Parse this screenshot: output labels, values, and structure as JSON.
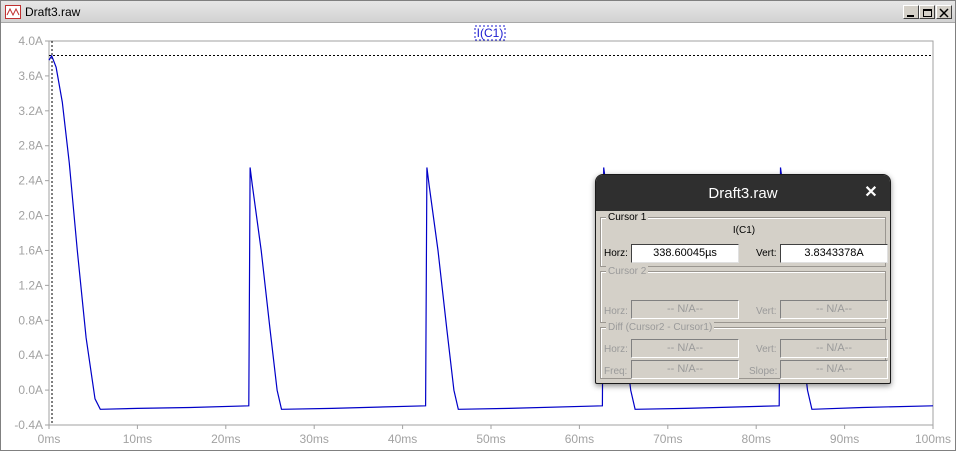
{
  "window": {
    "title": "Draft3.raw",
    "controls": [
      "minimize",
      "maximize",
      "close"
    ]
  },
  "plot": {
    "trace_label": "I(C1)",
    "trace_color": "#0000c8",
    "background": "#ffffff",
    "tick_color": "#a2a2a2"
  },
  "chart_data": {
    "type": "line",
    "title": "I(C1)",
    "xlabel": "",
    "ylabel": "",
    "xlim": [
      0,
      100
    ],
    "ylim": [
      -0.4,
      4.0
    ],
    "x_unit": "ms",
    "y_unit": "A",
    "x_ticks": [
      "0ms",
      "10ms",
      "20ms",
      "30ms",
      "40ms",
      "50ms",
      "60ms",
      "70ms",
      "80ms",
      "90ms",
      "100ms"
    ],
    "y_ticks": [
      "-0.4A",
      "0.0A",
      "0.4A",
      "0.8A",
      "1.2A",
      "1.6A",
      "2.0A",
      "2.4A",
      "2.8A",
      "3.2A",
      "3.6A",
      "4.0A"
    ],
    "cursor": {
      "x": 0.34,
      "y": 3.834
    },
    "series": [
      {
        "name": "I(C1)",
        "x": [
          0,
          0.3,
          0.8,
          1.5,
          2.3,
          3.2,
          4.2,
          5.2,
          5.8,
          10,
          16,
          22.6,
          22.75,
          23.0,
          24.0,
          25.0,
          25.8,
          26.3,
          32,
          42.6,
          42.75,
          43.0,
          44.0,
          45.0,
          45.8,
          46.3,
          52,
          62.6,
          62.75,
          63.0,
          64.0,
          65.0,
          65.8,
          66.3,
          72,
          82.6,
          82.75,
          83.0,
          84.0,
          85.0,
          85.8,
          86.3,
          92,
          100
        ],
        "y": [
          3.78,
          3.83,
          3.7,
          3.3,
          2.6,
          1.6,
          0.6,
          -0.1,
          -0.22,
          -0.21,
          -0.2,
          -0.18,
          2.55,
          2.35,
          1.6,
          0.7,
          0.0,
          -0.22,
          -0.21,
          -0.18,
          2.55,
          2.35,
          1.6,
          0.7,
          0.0,
          -0.22,
          -0.21,
          -0.18,
          2.55,
          2.35,
          1.6,
          0.7,
          0.0,
          -0.22,
          -0.21,
          -0.18,
          2.55,
          2.35,
          1.6,
          0.7,
          0.0,
          -0.22,
          -0.2,
          -0.18
        ]
      }
    ]
  },
  "dialog": {
    "title": "Draft3.raw",
    "close_symbol": "✕",
    "cursor1": {
      "group_label": "Cursor 1",
      "trace": "I(C1)",
      "horz_label": "Horz:",
      "horz_value": "338.60045µs",
      "vert_label": "Vert:",
      "vert_value": "3.8343378A"
    },
    "cursor2": {
      "group_label": "Cursor 2",
      "horz_label": "Horz:",
      "horz_value": "-- N/A--",
      "vert_label": "Vert:",
      "vert_value": "-- N/A--"
    },
    "diff": {
      "group_label": "Diff (Cursor2 - Cursor1)",
      "horz_label": "Horz:",
      "horz_value": "-- N/A--",
      "vert_label": "Vert:",
      "vert_value": "-- N/A--",
      "freq_label": "Freq:",
      "freq_value": "-- N/A--",
      "slope_label": "Slope:",
      "slope_value": "-- N/A--"
    }
  }
}
